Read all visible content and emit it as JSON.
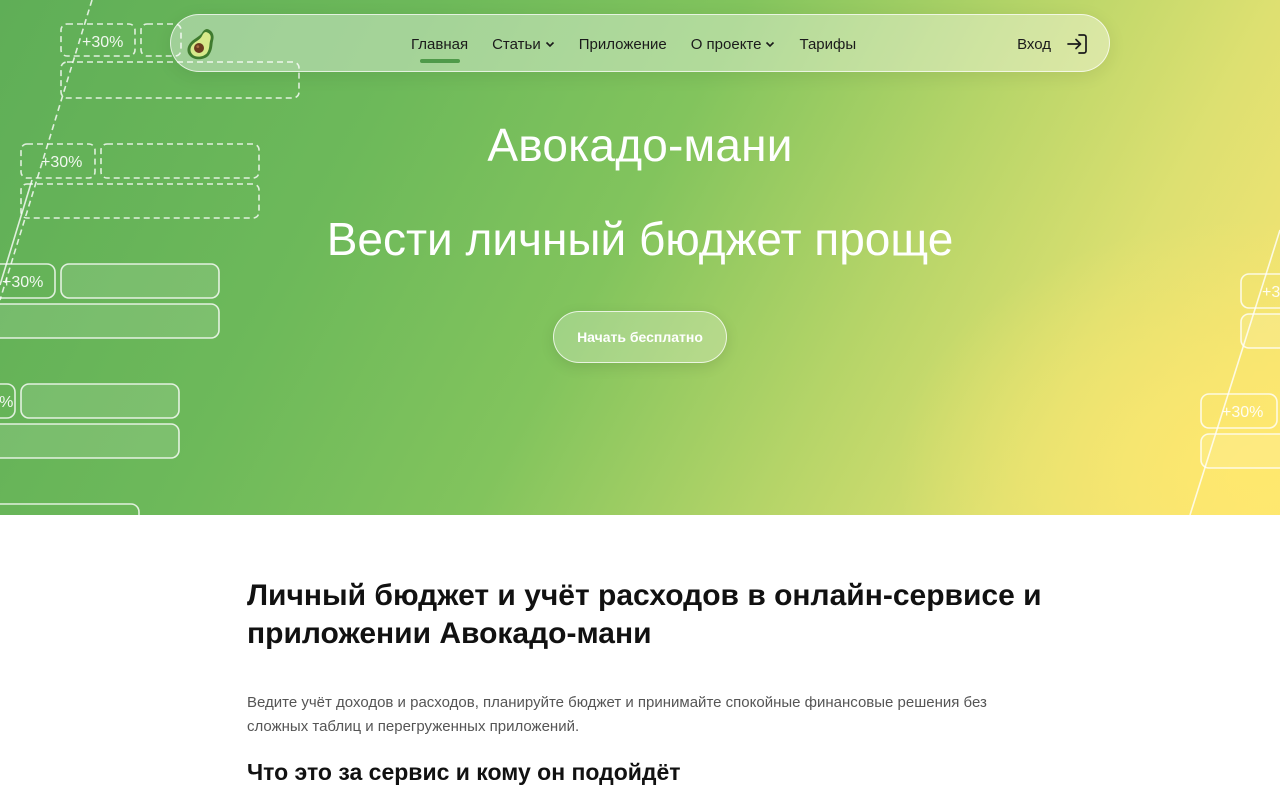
{
  "nav": {
    "logo_icon": "avocado-icon",
    "items": [
      {
        "label": "Главная",
        "active": true,
        "dropdown": false
      },
      {
        "label": "Статьи",
        "active": false,
        "dropdown": true
      },
      {
        "label": "Приложение",
        "active": false,
        "dropdown": false
      },
      {
        "label": "О проекте",
        "active": false,
        "dropdown": true
      },
      {
        "label": "Тарифы",
        "active": false,
        "dropdown": false
      }
    ],
    "login_label": "Вход",
    "login_icon": "login-arrow-icon",
    "accent_color": "#4f9a4a"
  },
  "hero": {
    "brand_title": "Авокадо-мани",
    "subtitle": "Вести личный бюджет проще",
    "cta_label": "Начать бесплатно",
    "deco_badge": "+30%",
    "gradient_colors": [
      "#5fae57",
      "#82c45d",
      "#dde071",
      "#fde573"
    ]
  },
  "content": {
    "heading": "Личный бюджет и учёт расходов в онлайн-сервисе и приложении Авокадо-мани",
    "lead": "Ведите учёт доходов и расходов, планируйте бюджет и принимайте спокойные финансовые решения без сложных таблиц и перегруженных приложений.",
    "subheading": "Что это за сервис и кому он подойдёт"
  }
}
